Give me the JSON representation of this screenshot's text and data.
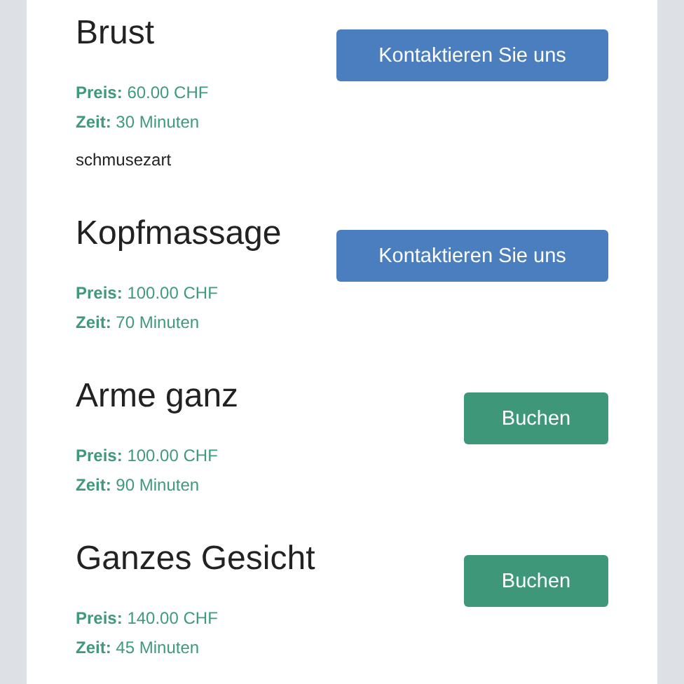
{
  "services": [
    {
      "title": "Brust",
      "price": "**Preis:** 60.00 CHF",
      "time": "**Zeit:** 30 Minuten",
      "description": "schmusezart",
      "button": {
        "kind": "contact",
        "label": "Kontaktieren Sie uns"
      }
    },
    {
      "title": "Kopfmassage",
      "price": "**Preis:** 100.00 CHF",
      "time": "**Zeit:** 70 Minuten",
      "button": {
        "kind": "contact",
        "label": "Kontaktieren Sie uns"
      }
    },
    {
      "title": "Arme ganz",
      "price": "**Preis:** 100.00 CHF",
      "time": "**Zeit:** 90 Minuten",
      "button": {
        "kind": "book",
        "label": "Buchen"
      }
    },
    {
      "title": "Ganzes Gesicht",
      "price": "**Preis:** 140.00 CHF",
      "time": "**Zeit:** 45 Minuten",
      "button": {
        "kind": "book",
        "label": "Buchen"
      }
    }
  ]
}
